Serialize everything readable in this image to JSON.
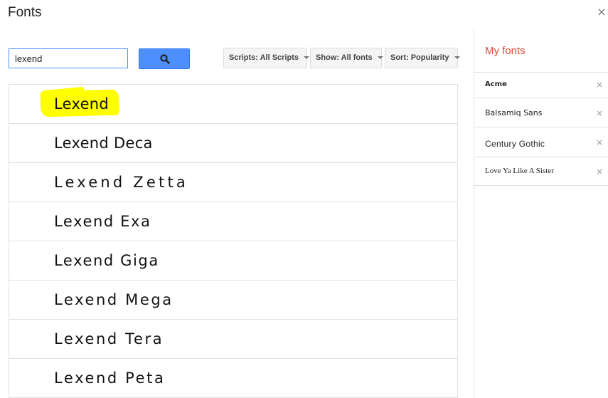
{
  "dialog": {
    "title": "Fonts",
    "close_icon": "close-icon",
    "close_glyph": "×"
  },
  "search": {
    "value": "lexend",
    "button_icon": "search-icon"
  },
  "filters": [
    {
      "label": "Scripts: All Scripts"
    },
    {
      "label": "Show: All fonts"
    },
    {
      "label": "Sort: Popularity"
    }
  ],
  "font_list": [
    {
      "name": "Lexend",
      "highlighted": true
    },
    {
      "name": "Lexend Deca",
      "highlighted": false
    },
    {
      "name": "Lexend Zetta",
      "highlighted": false
    },
    {
      "name": "Lexend Exa",
      "highlighted": false
    },
    {
      "name": "Lexend Giga",
      "highlighted": false
    },
    {
      "name": "Lexend Mega",
      "highlighted": false
    },
    {
      "name": "Lexend Tera",
      "highlighted": false
    },
    {
      "name": "Lexend Peta",
      "highlighted": false
    }
  ],
  "my_fonts": {
    "title": "My fonts",
    "remove_glyph": "×",
    "items": [
      {
        "name": "Acme"
      },
      {
        "name": "Balsamiq Sans"
      },
      {
        "name": "Century Gothic"
      },
      {
        "name": "Love Ya Like A Sister"
      }
    ]
  },
  "colors": {
    "accent_blue": "#4d8ffd",
    "my_fonts_red": "#dd4b39",
    "highlight_yellow": "#ffff00"
  }
}
